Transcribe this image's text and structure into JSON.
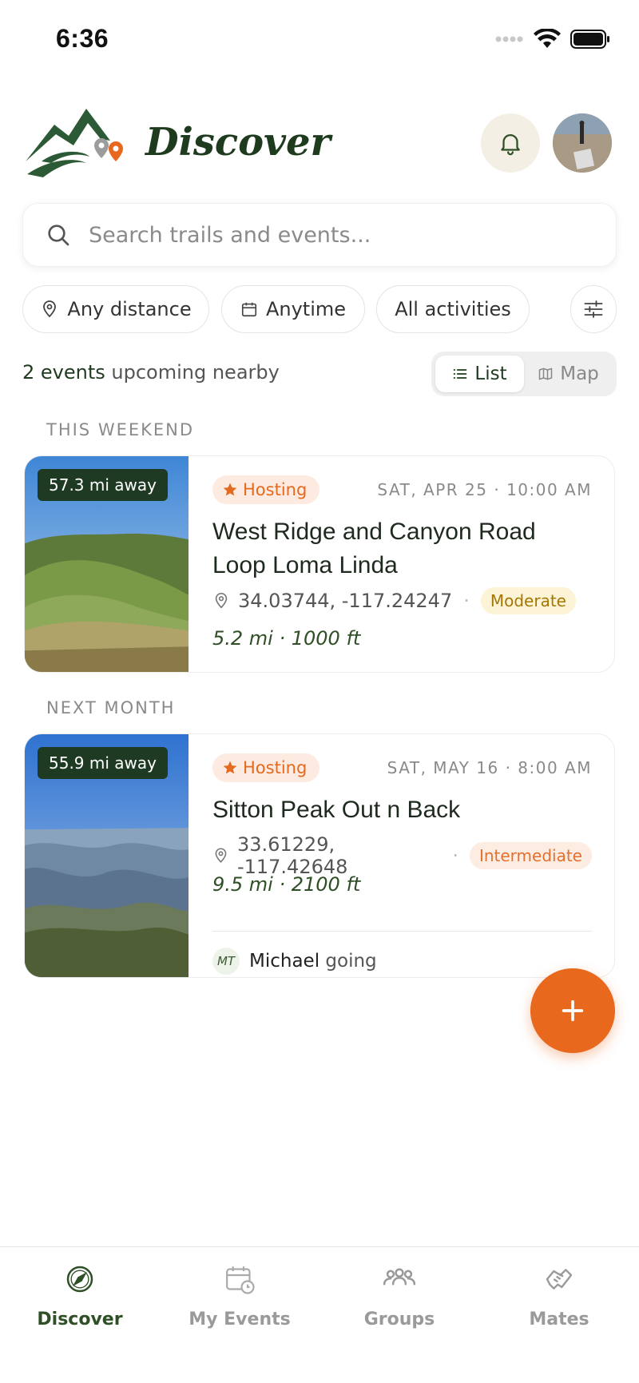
{
  "status": {
    "time": "6:36"
  },
  "header": {
    "title": "Discover"
  },
  "search": {
    "placeholder": "Search trails and events..."
  },
  "filters": [
    {
      "label": "Any distance",
      "icon": "map-pin-icon"
    },
    {
      "label": "Anytime",
      "icon": "calendar-icon"
    },
    {
      "label": "All activities"
    }
  ],
  "summary": {
    "count_bold": "2 events",
    "count_rest": " upcoming nearby"
  },
  "view_toggle": {
    "list_label": "List",
    "map_label": "Map",
    "selected": "List"
  },
  "sections": [
    {
      "label": "THIS WEEKEND",
      "event": {
        "distance": "57.3 mi away",
        "hosting_label": "Hosting",
        "date": "SAT, APR 25 · 10:00 AM",
        "title": "West Ridge and Canyon Road Loop Loma Linda",
        "coords": "34.03744, -117.24247",
        "difficulty": "Moderate",
        "stats": "5.2 mi · 1000 ft"
      }
    },
    {
      "label": "NEXT MONTH",
      "event": {
        "distance": "55.9 mi away",
        "hosting_label": "Hosting",
        "date": "SAT, MAY 16 · 8:00 AM",
        "title": "Sitton Peak Out n Back",
        "coords": "33.61229, -117.42648",
        "difficulty": "Intermediate",
        "stats": "9.5 mi · 2100 ft",
        "attendee_initials": "MT",
        "attendee_name": "Michael",
        "attendee_suffix": " going"
      }
    }
  ],
  "tabs": [
    {
      "label": "Discover",
      "icon": "compass-icon",
      "active": true
    },
    {
      "label": "My Events",
      "icon": "calendar-clock-icon",
      "active": false
    },
    {
      "label": "Groups",
      "icon": "people-icon",
      "active": false
    },
    {
      "label": "Mates",
      "icon": "handshake-icon",
      "active": false
    }
  ],
  "colors": {
    "brand_green": "#1e3b1e",
    "accent_orange": "#e8681d"
  }
}
